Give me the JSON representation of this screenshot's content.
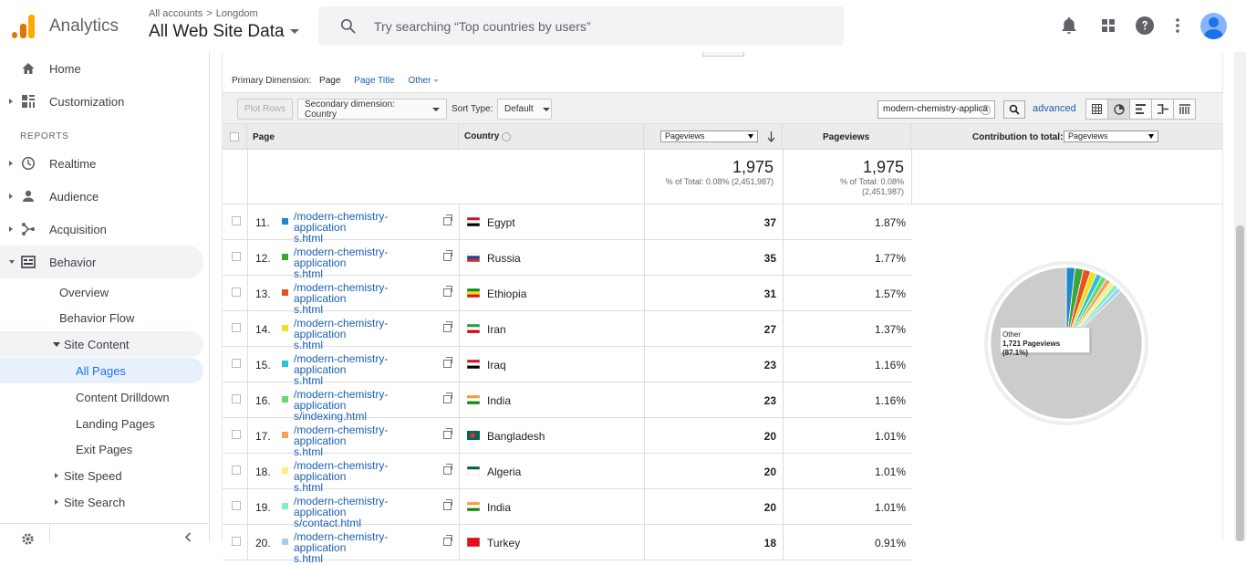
{
  "header": {
    "brand": "Analytics",
    "breadcrumb": [
      "All accounts",
      "Longdom"
    ],
    "breadcrumb_sep": ">",
    "property": "All Web Site Data",
    "search_placeholder": "Try searching “Top countries by users”"
  },
  "sidebar": {
    "home": "Home",
    "customization": "Customization",
    "reports_label": "REPORTS",
    "realtime": "Realtime",
    "audience": "Audience",
    "acquisition": "Acquisition",
    "behavior": "Behavior",
    "overview": "Overview",
    "behavior_flow": "Behavior Flow",
    "site_content": "Site Content",
    "all_pages": "All Pages",
    "content_drilldown": "Content Drilldown",
    "landing_pages": "Landing Pages",
    "exit_pages": "Exit Pages",
    "site_speed": "Site Speed",
    "site_search": "Site Search"
  },
  "report": {
    "primary_label": "Primary Dimension:",
    "primary_current": "Page",
    "primary_option_1": "Page Title",
    "primary_option_2": "Other",
    "plot_rows": "Plot Rows",
    "secondary_dimension": "Secondary dimension: Country",
    "sort_type_label": "Sort Type:",
    "sort_type_value": "Default",
    "filter_value": "modern-chemistry-applica",
    "advanced": "advanced"
  },
  "table": {
    "col_page": "Page",
    "col_country": "Country",
    "col_metric_select": "Pageviews",
    "col_pageviews": "Pageviews",
    "col_contribution": "Contribution to total:",
    "contribution_select": "Pageviews",
    "total_1": "1,975",
    "total_1_sub": "% of Total: 0.08% (2,451,987)",
    "total_2": "1,975",
    "total_2_sub_1": "% of Total: 0.08%",
    "total_2_sub_2": "(2,451,987)",
    "rows": [
      {
        "num": "11.",
        "color": "#1e88c8",
        "page_1": "/modern-chemistry-application",
        "page_2": "s.html",
        "country": "Egypt",
        "pageviews": "37",
        "pct": "1.87%"
      },
      {
        "num": "12.",
        "color": "#3aa53a",
        "page_1": "/modern-chemistry-application",
        "page_2": "s.html",
        "country": "Russia",
        "pageviews": "35",
        "pct": "1.77%"
      },
      {
        "num": "13.",
        "color": "#e8521e",
        "page_1": "/modern-chemistry-application",
        "page_2": "s.html",
        "country": "Ethiopia",
        "pageviews": "31",
        "pct": "1.57%"
      },
      {
        "num": "14.",
        "color": "#f0e020",
        "page_1": "/modern-chemistry-application",
        "page_2": "s.html",
        "country": "Iran",
        "pageviews": "27",
        "pct": "1.37%"
      },
      {
        "num": "15.",
        "color": "#2ac0e0",
        "page_1": "/modern-chemistry-application",
        "page_2": "s.html",
        "country": "Iraq",
        "pageviews": "23",
        "pct": "1.16%"
      },
      {
        "num": "16.",
        "color": "#6ad86a",
        "page_1": "/modern-chemistry-application",
        "page_2": "s/indexing.html",
        "country": "India",
        "pageviews": "23",
        "pct": "1.16%"
      },
      {
        "num": "17.",
        "color": "#f4a060",
        "page_1": "/modern-chemistry-application",
        "page_2": "s.html",
        "country": "Bangladesh",
        "pageviews": "20",
        "pct": "1.01%"
      },
      {
        "num": "18.",
        "color": "#f8f080",
        "page_1": "/modern-chemistry-application",
        "page_2": "s.html",
        "country": "Algeria",
        "pageviews": "20",
        "pct": "1.01%"
      },
      {
        "num": "19.",
        "color": "#80f0c0",
        "page_1": "/modern-chemistry-application",
        "page_2": "s/contact.html",
        "country": "India",
        "pageviews": "20",
        "pct": "1.01%"
      },
      {
        "num": "20.",
        "color": "#a0d0f0",
        "page_1": "/modern-chemistry-application",
        "page_2": "s.html",
        "country": "Turkey",
        "pageviews": "18",
        "pct": "0.91%"
      }
    ]
  },
  "chart_data": {
    "type": "pie",
    "slices": [
      {
        "label": "11",
        "percent": 1.87,
        "color": "#1e88c8"
      },
      {
        "label": "12",
        "percent": 1.77,
        "color": "#3aa53a"
      },
      {
        "label": "13",
        "percent": 1.57,
        "color": "#e8521e"
      },
      {
        "label": "14",
        "percent": 1.37,
        "color": "#f0e020"
      },
      {
        "label": "15",
        "percent": 1.16,
        "color": "#2ac0e0"
      },
      {
        "label": "16",
        "percent": 1.16,
        "color": "#6ad86a"
      },
      {
        "label": "17",
        "percent": 1.01,
        "color": "#f4a060"
      },
      {
        "label": "18",
        "percent": 1.01,
        "color": "#f8f080"
      },
      {
        "label": "19",
        "percent": 1.01,
        "color": "#80f0c0"
      },
      {
        "label": "20",
        "percent": 0.91,
        "color": "#a0d0f0"
      },
      {
        "label": "Other",
        "percent": 87.1,
        "color": "#cccccc"
      }
    ],
    "tooltip_title": "Other",
    "tooltip_value": "1,721 Pageviews (87.1%)"
  }
}
